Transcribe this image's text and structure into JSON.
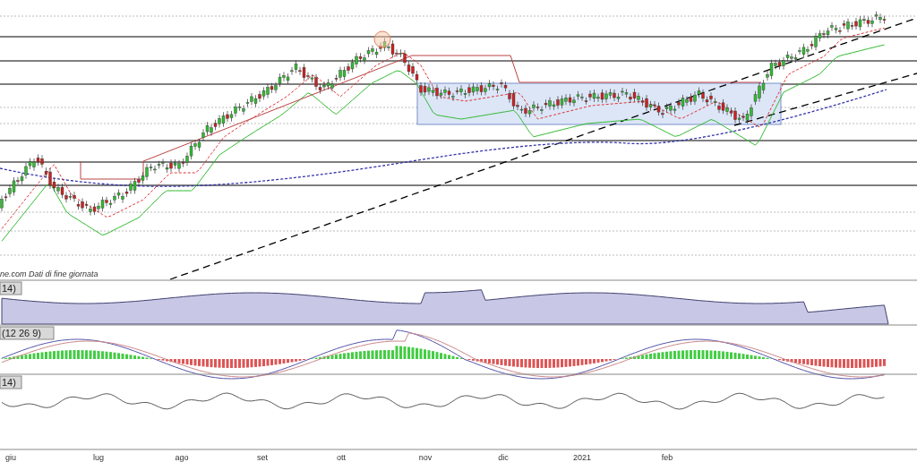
{
  "source_note": "ne.com Dati di fine giornata",
  "indicators": [
    {
      "label": "14)",
      "kind": "area"
    },
    {
      "label": "(12 26 9)",
      "kind": "macd"
    },
    {
      "label": "14)",
      "kind": "line"
    }
  ],
  "x_axis": [
    "giu",
    "lug",
    "ago",
    "set",
    "ott",
    "nov",
    "dic",
    "2021",
    "feb"
  ]
}
